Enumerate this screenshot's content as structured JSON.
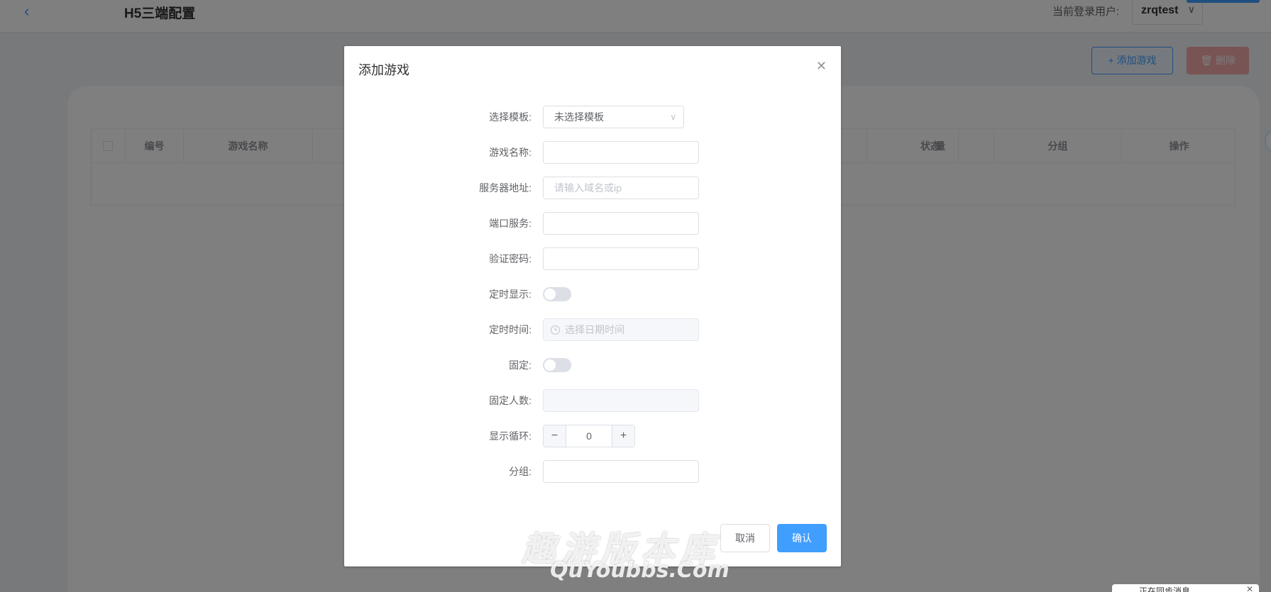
{
  "header": {
    "back_icon": "chevron-left-icon",
    "title": "H5三端配置",
    "user_label": "当前登录用户:",
    "user_name": "zrqtest"
  },
  "toolbar": {
    "add_game_label": "+ 添加游戏",
    "delete_label": "🗑 删除"
  },
  "table": {
    "headers": [
      "编号",
      "游戏名称",
      "量",
      "状态",
      "分组",
      "操作"
    ]
  },
  "dialog": {
    "title": "添加游戏",
    "close_icon": "close-icon",
    "fields": {
      "template": {
        "label": "选择模板:",
        "value": "未选择模板"
      },
      "game_name": {
        "label": "游戏名称:",
        "value": ""
      },
      "server_address": {
        "label": "服务器地址:",
        "placeholder": "请输入域名或ip"
      },
      "port_service": {
        "label": "端口服务:",
        "value": ""
      },
      "verify_password": {
        "label": "验证密码:",
        "value": ""
      },
      "timed_display": {
        "label": "定时显示:",
        "enabled": false
      },
      "timed_time": {
        "label": "定时时间:",
        "placeholder": "选择日期时间"
      },
      "fixed": {
        "label": "固定:",
        "enabled": false
      },
      "fixed_count": {
        "label": "固定人数:",
        "value": ""
      },
      "display_loop": {
        "label": "显示循环:",
        "value": "0",
        "minus": "−",
        "plus": "+"
      },
      "group": {
        "label": "分组:",
        "value": ""
      }
    },
    "cancel_label": "取消",
    "confirm_label": "确认"
  },
  "watermark": {
    "cn": "趣游版本库",
    "en": "QuYoubbs.Com"
  },
  "notification": {
    "text": "正在同步消息"
  },
  "colors": {
    "primary": "#409eff",
    "danger": "#f56c6c",
    "overlay": "rgba(0,0,0,0.5)"
  }
}
